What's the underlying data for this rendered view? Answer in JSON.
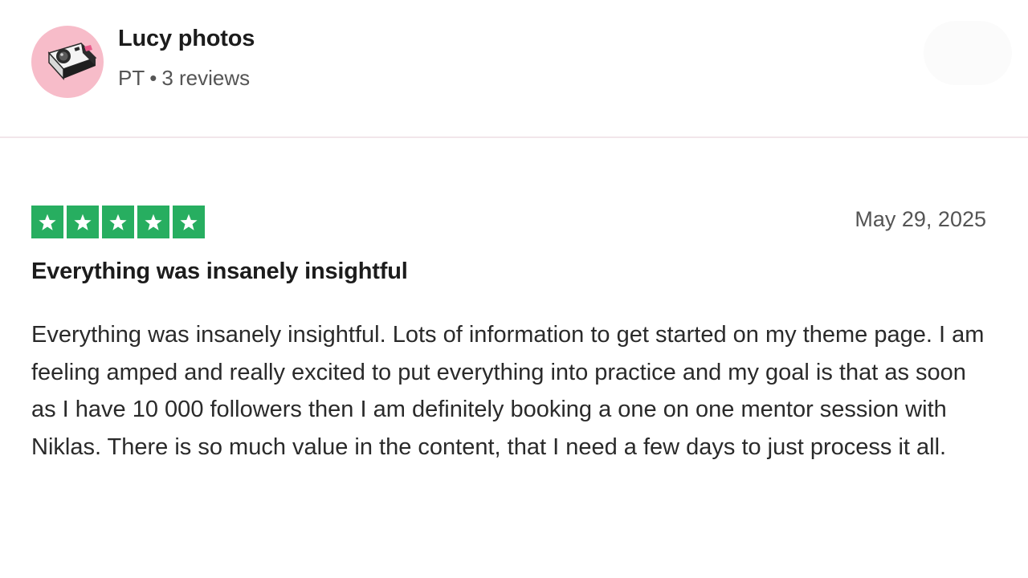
{
  "reviewer": {
    "name": "Lucy photos",
    "country": "PT",
    "separator": "•",
    "reviews_count": "3 reviews",
    "avatar_icon": "polaroid-camera-icon",
    "avatar_bg": "#f7bcc9"
  },
  "review": {
    "rating": 5,
    "rating_max": 5,
    "star_color": "#27ae60",
    "date": "May 29, 2025",
    "title": "Everything was insanely insightful",
    "body": "Everything was insanely insightful. Lots of information to get started on my theme page. I am feeling amped and really excited to put everything into practice and my goal is that as soon as I have 10 000 followers then I am definitely booking a one on one mentor session with Niklas. There is so much value in the content, that I need a few days to just process it all."
  }
}
